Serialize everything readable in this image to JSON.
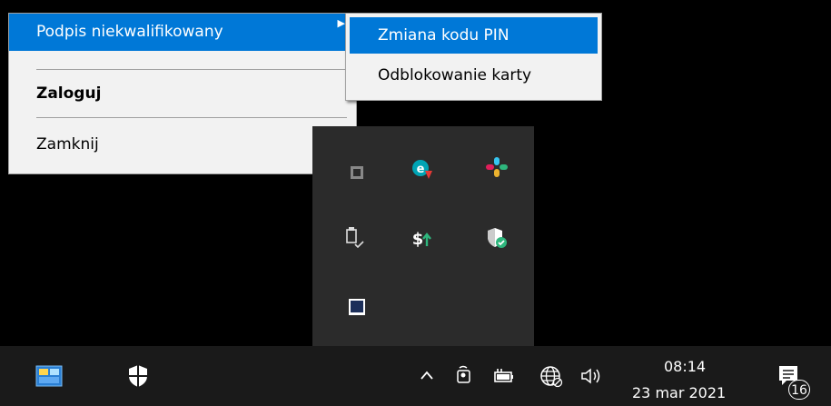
{
  "context_menu": {
    "items": [
      {
        "label": "Podpis niekwalifikowany"
      },
      {
        "label": "Zaloguj"
      },
      {
        "label": "Zamknij"
      }
    ]
  },
  "submenu": {
    "items": [
      {
        "label": "Zmiana kodu PIN"
      },
      {
        "label": "Odblokowanie karty"
      }
    ]
  },
  "tray_panel": {
    "icons": [
      "partial-app-icon",
      "eset-warning-icon",
      "slack-icon",
      "usb-safely-remove-icon",
      "sync-update-icon",
      "security-shield-check-icon",
      "smartcard-reader-icon"
    ]
  },
  "taskbar": {
    "clock_time": "08:14",
    "clock_date": "23 mar 2021",
    "notification_count": "16",
    "icons": [
      "app-taskbar-icon",
      "security-taskbar-icon",
      "show-hidden-icons-chevron",
      "meeting-icon",
      "battery-power-icon",
      "network-icon",
      "volume-icon",
      "action-center-icon"
    ]
  },
  "colors": {
    "highlight": "#0078d7",
    "menu_bg": "#f2f2f2",
    "taskbar_bg": "#1a1a1a",
    "tray_panel_bg": "#2b2b2b"
  }
}
